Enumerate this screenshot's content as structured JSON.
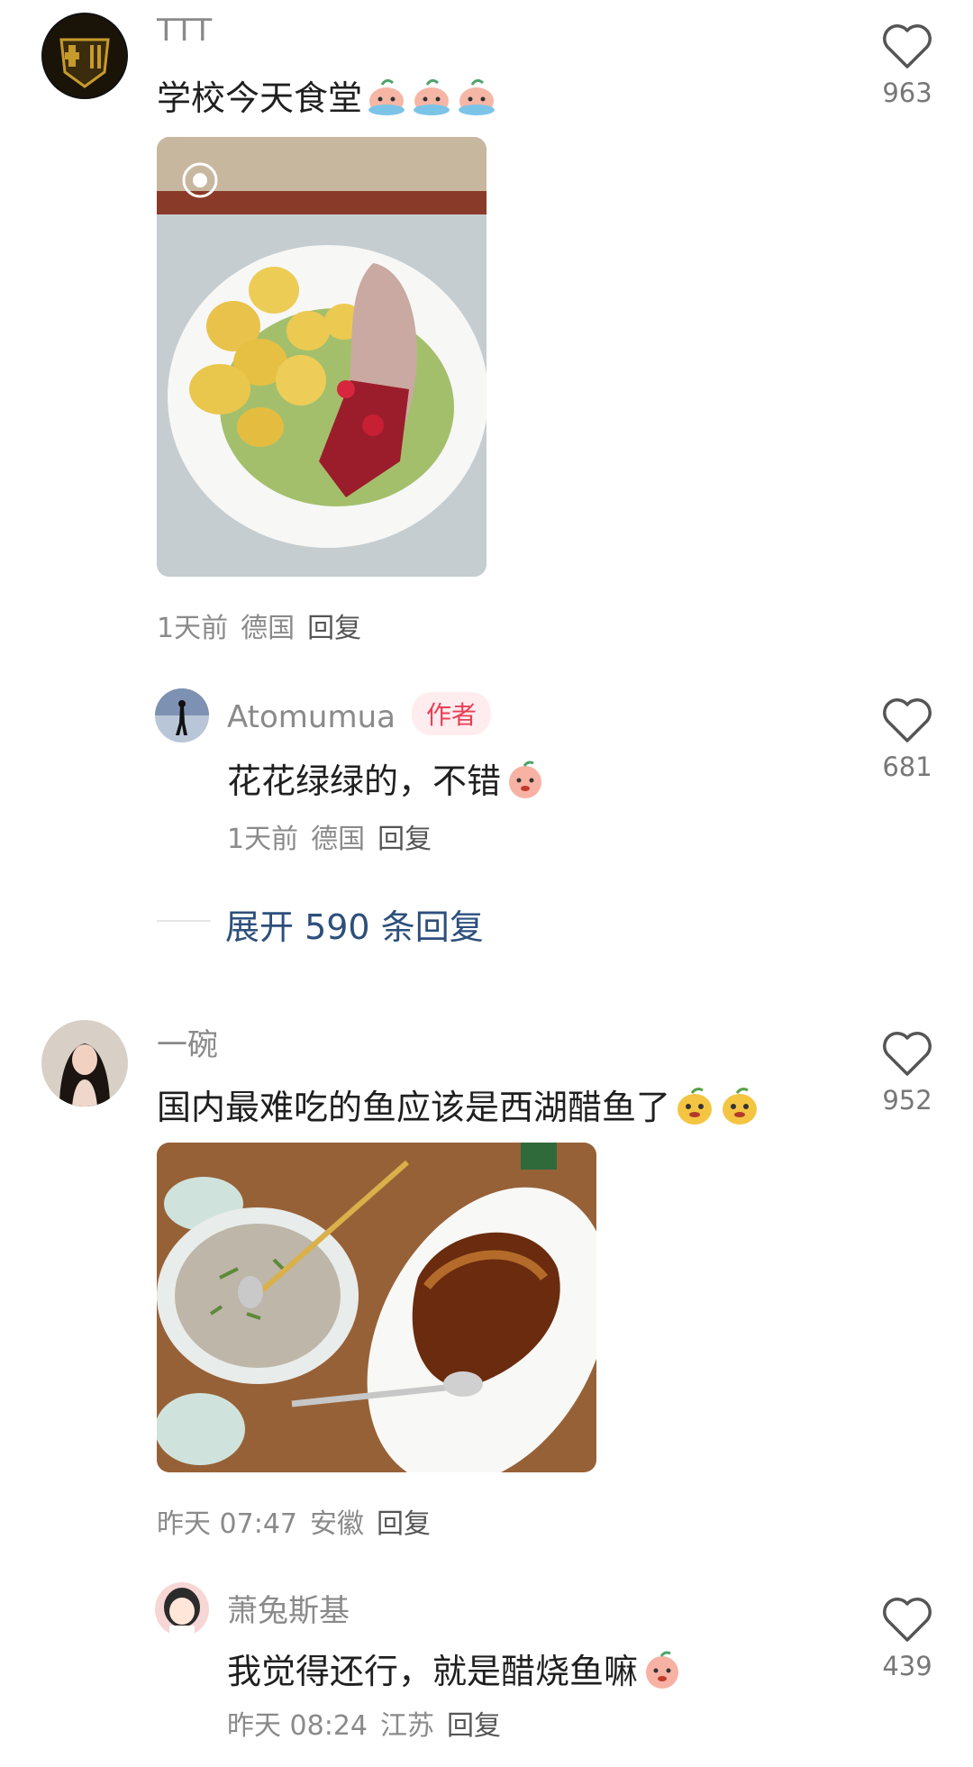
{
  "comments": [
    {
      "username": "TTT",
      "text": "学校今天食堂",
      "likes": "963",
      "time": "1天前",
      "location": "德国",
      "reply_label": "回复",
      "replies": [
        {
          "username": "Atomumua",
          "badge": "作者",
          "text": "花花绿绿的，不错",
          "likes": "681",
          "time": "1天前",
          "location": "德国",
          "reply_label": "回复"
        }
      ],
      "expand_label": "展开 590 条回复"
    },
    {
      "username": "一碗",
      "text": "国内最难吃的鱼应该是西湖醋鱼了",
      "likes": "952",
      "time": "昨天 07:47",
      "location": "安徽",
      "reply_label": "回复",
      "replies": [
        {
          "username": "萧兔斯基",
          "text": "我觉得还行，就是醋烧鱼嘛",
          "likes": "439",
          "time": "昨天 08:24",
          "location": "江苏",
          "reply_label": "回复"
        }
      ]
    }
  ],
  "colors": {
    "accent": "#e83f55",
    "link": "#2c4f7c",
    "muted": "#8a8a8a"
  },
  "icons": {
    "like": "heart-outline-icon",
    "emoji": "peach-emoji-icon"
  }
}
